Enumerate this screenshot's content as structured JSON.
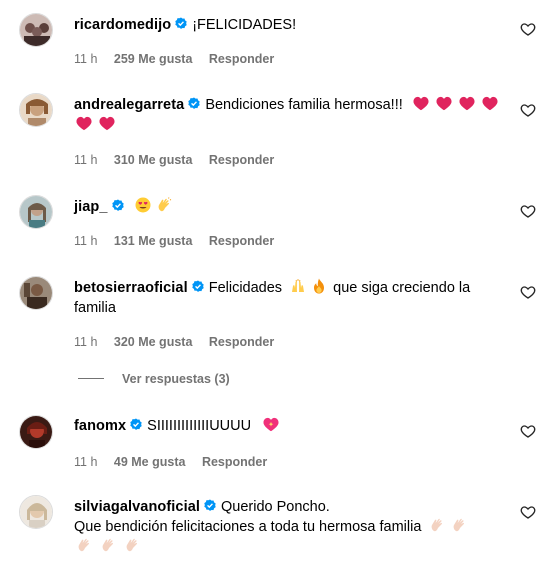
{
  "comments": [
    {
      "username": "ricardomedijo",
      "text": "¡FELICIDADES!",
      "time": "11 h",
      "likes": "259 Me gusta",
      "reply": "Responder",
      "avatar_color": "#7a5c58"
    },
    {
      "username": "andrealegarreta",
      "text": "Bendiciones familia hermosa!!!",
      "time": "11 h",
      "likes": "310 Me gusta",
      "reply": "Responder",
      "avatar_color": "#c9a17e"
    },
    {
      "username": "jiap_",
      "text": "",
      "time": "11 h",
      "likes": "131 Me gusta",
      "reply": "Responder",
      "avatar_color": "#8c7a6b"
    },
    {
      "username": "betosierraoficial",
      "text": "Felicidades",
      "text2": "que siga creciendo la",
      "text3": "familia",
      "time": "11 h",
      "likes": "320 Me gusta",
      "reply": "Responder",
      "avatar_color": "#5a4636"
    },
    {
      "username": "fanomx",
      "text": "SIIIIIIIIIIIIIUUUU",
      "time": "11 h",
      "likes": "49 Me gusta",
      "reply": "Responder",
      "avatar_color": "#b23a2a"
    },
    {
      "username": "silviagalvanoficial",
      "text": "Querido Poncho.",
      "text2": "Que bendición felicitaciones a toda tu hermosa familia",
      "avatar_color": "#d9d0c4"
    }
  ],
  "view_replies": "Ver respuestas (3)",
  "colors": {
    "verified": "#0095f6",
    "meta": "#737373",
    "red_heart": "#e0245e"
  },
  "icons": [
    "verified-badge-icon",
    "heart-outline-icon",
    "red-heart-emoji",
    "heart-eyes-emoji",
    "clapping-hands-emoji",
    "raised-hands-emoji",
    "fire-emoji",
    "sparkling-heart-emoji"
  ]
}
